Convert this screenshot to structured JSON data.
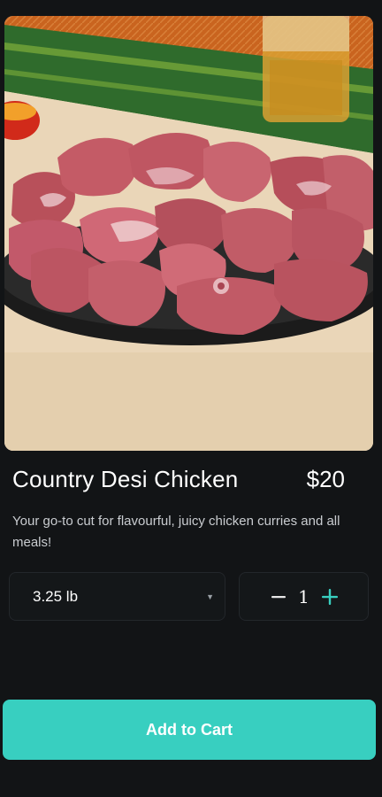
{
  "product": {
    "image_icon": "meat-plate-image",
    "title": "Country Desi Chicken",
    "price": "$20",
    "description": "Your go-to cut for flavourful, juicy chicken curries and all meals!"
  },
  "weight_select": {
    "value": "3.25 lb",
    "icon": "caret-down-icon"
  },
  "quantity": {
    "value": "1",
    "decrement_icon": "minus-icon",
    "increment_icon": "plus-icon"
  },
  "cart": {
    "button_label": "Add to Cart"
  },
  "colors": {
    "background": "#121416",
    "accent": "#38cfc0",
    "text_primary": "#ffffff",
    "text_secondary": "#c9ccd0"
  }
}
